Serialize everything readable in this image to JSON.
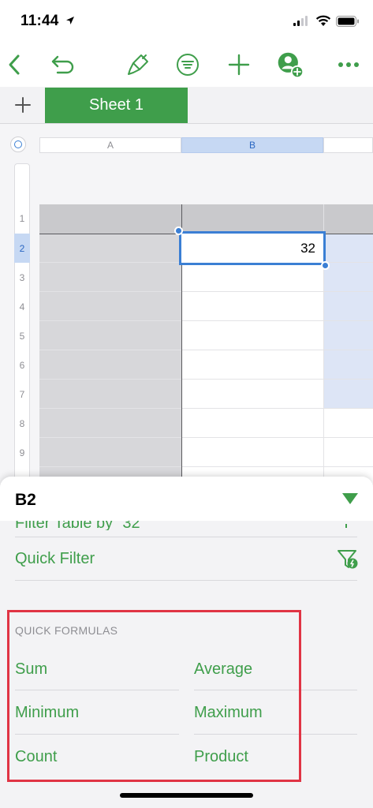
{
  "status_bar": {
    "time": "11:44"
  },
  "toolbar": {
    "back": "back-chevron",
    "undo": "undo",
    "format": "paintbrush",
    "organize": "sort-filter",
    "insert": "plus",
    "collaborate": "add-person",
    "more": "ellipsis"
  },
  "tabs": {
    "add": "+",
    "active": "Sheet 1"
  },
  "grid": {
    "columns": [
      "A",
      "B"
    ],
    "rows": [
      "1",
      "2",
      "3",
      "4",
      "5",
      "6",
      "7",
      "8",
      "9"
    ],
    "selected_cell_value": "32"
  },
  "panel": {
    "title": "B2",
    "peek_item": "Filter Table by “32”",
    "quick_filter": "Quick Filter",
    "section_title": "QUICK FORMULAS",
    "formulas": {
      "sum": "Sum",
      "average": "Average",
      "minimum": "Minimum",
      "maximum": "Maximum",
      "count": "Count",
      "product": "Product"
    }
  },
  "colors": {
    "accent": "#3f9e4b",
    "selection": "#3b7fd4",
    "highlight": "#e03444"
  }
}
